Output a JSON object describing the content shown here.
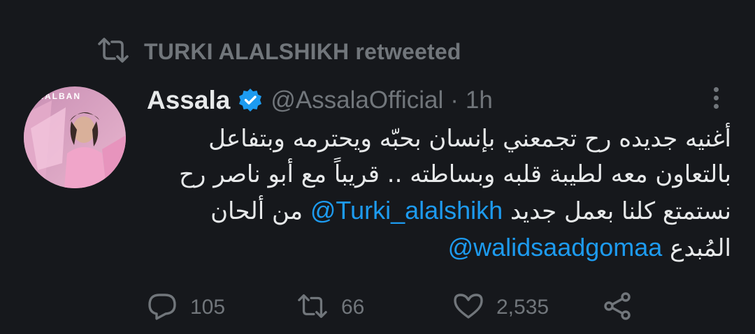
{
  "retweet": {
    "label": "TURKI ALALSHIKH retweeted",
    "icon": "retweet-icon"
  },
  "tweet": {
    "display_name": "Assala",
    "verified": true,
    "handle": "@AssalaOfficial",
    "separator": "·",
    "time": "1h",
    "lines": [
      {
        "text": "أغنيه جديده رح تجمعني بإنسان بحبّه ويحترمه وبتفاعل"
      },
      {
        "text": "بالتعاون معه لطيبة قلبه وبساطته .. قريباً مع أبو ناصر رح"
      },
      {
        "text_before": "نستمتع كلنا بعمل جديد ",
        "mention": "@Turki_alalshikh",
        "text_after": "  من ألحان"
      },
      {
        "text_before": "المُبدع ",
        "mention": "@walidsaadgomaa"
      }
    ]
  },
  "actions": {
    "reply": {
      "count": "105",
      "icon": "reply-icon"
    },
    "retweet": {
      "count": "66",
      "icon": "retweet-icon"
    },
    "like": {
      "count": "2,535",
      "icon": "heart-icon"
    },
    "share": {
      "icon": "share-icon"
    }
  },
  "colors": {
    "background": "#16181c",
    "text": "#e7e9ea",
    "muted": "#71767b",
    "link": "#1d9bf0"
  }
}
